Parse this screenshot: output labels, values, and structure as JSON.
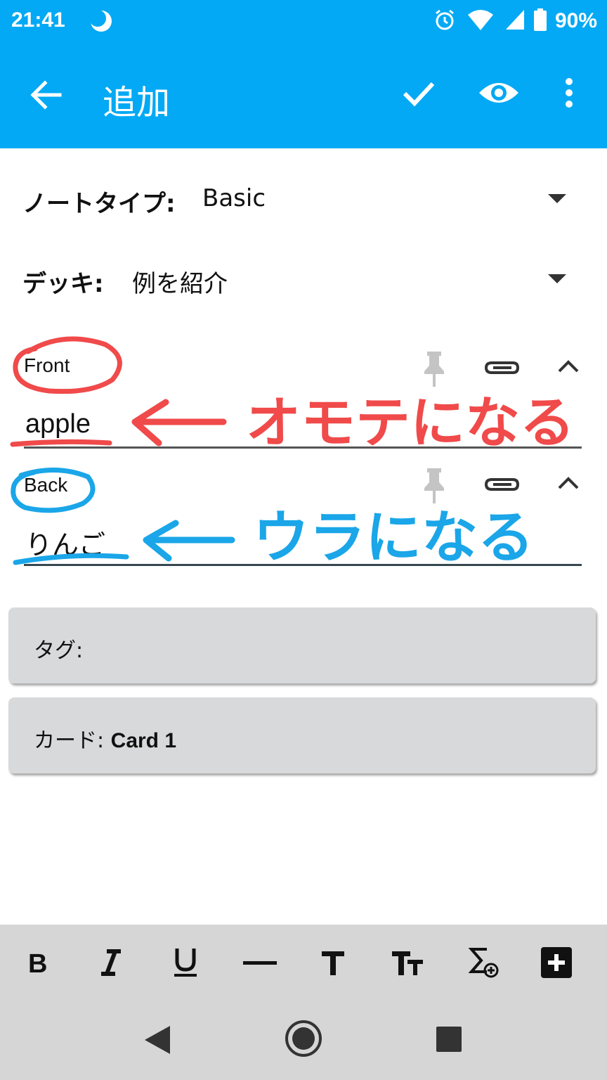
{
  "status_bar": {
    "time": "21:41",
    "battery": "90%"
  },
  "toolbar": {
    "title": "追加"
  },
  "note_type": {
    "label": "ノートタイプ:",
    "value": "Basic"
  },
  "deck": {
    "label": "デッキ:",
    "value": "例を紹介"
  },
  "fields": [
    {
      "label": "Front",
      "value": "apple"
    },
    {
      "label": "Back",
      "value": "りんご"
    }
  ],
  "tags": {
    "label": "タグ:"
  },
  "cards": {
    "label": "カード:",
    "value": "Card 1"
  },
  "annotations": {
    "front_note": "オモテになる",
    "back_note": "ウラになる",
    "front_color": "#f04a4a",
    "back_color": "#1aa6e8"
  },
  "colors": {
    "appbar": "#03a9f4",
    "bar": "#d6d6d6",
    "card": "#d8d9da"
  }
}
